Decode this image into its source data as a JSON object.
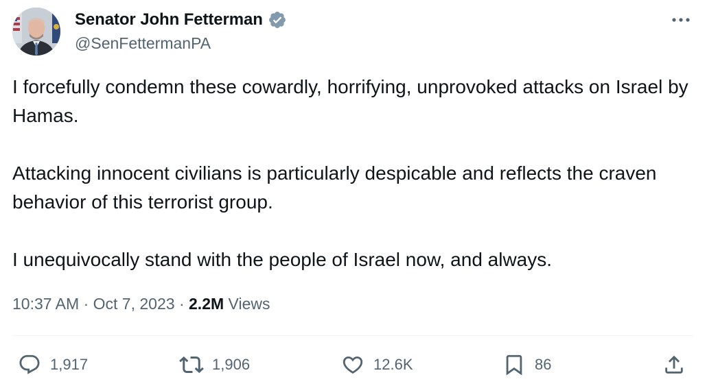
{
  "author": {
    "display_name": "Senator John Fetterman",
    "handle": "@SenFettermanPA",
    "verified_icon": "verified-badge-icon",
    "verified_color": "#829aab"
  },
  "tweet": {
    "paragraphs": [
      "I forcefully condemn these cowardly, horrifying, unprovoked attacks on Israel by Hamas.",
      "Attacking innocent civilians is particularly despicable and reflects the craven behavior of this terrorist group.",
      "I unequivocally stand with the people of Israel now, and always."
    ],
    "time": "10:37 AM",
    "date": "Oct 7, 2023",
    "separator": "·",
    "views_count": "2.2M",
    "views_label": "Views"
  },
  "actions": {
    "reply": {
      "count": "1,917",
      "icon": "reply-icon"
    },
    "retweet": {
      "count": "1,906",
      "icon": "retweet-icon"
    },
    "like": {
      "count": "12.6K",
      "icon": "heart-icon"
    },
    "bookmark": {
      "count": "86",
      "icon": "bookmark-icon"
    },
    "share": {
      "icon": "share-icon"
    }
  },
  "colors": {
    "text_primary": "#0f1419",
    "text_secondary": "#536471",
    "divider": "#eff3f4",
    "icon": "#536471"
  }
}
